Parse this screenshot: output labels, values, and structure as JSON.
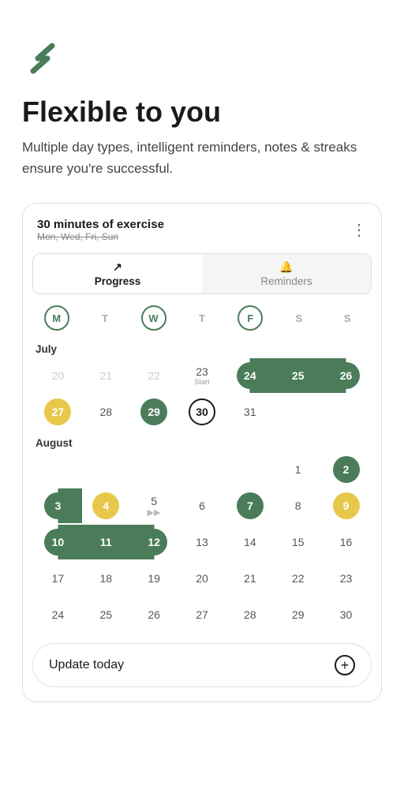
{
  "app": {
    "logo_color": "#4a7c59"
  },
  "header": {
    "headline": "Flexible to you",
    "subheadline": "Multiple day types, intelligent reminders, notes & streaks ensure you're successful."
  },
  "card": {
    "title": "30 minutes of exercise",
    "subtitle": "Mon, Wed, Fri, Sun",
    "more_icon": "⋮",
    "tabs": [
      {
        "id": "progress",
        "label": "Progress",
        "icon": "↗",
        "active": true
      },
      {
        "id": "reminders",
        "label": "Reminders",
        "icon": "🔔",
        "active": false
      }
    ],
    "weekdays": [
      {
        "label": "M",
        "active": true
      },
      {
        "label": "T",
        "active": false
      },
      {
        "label": "W",
        "active": true
      },
      {
        "label": "T",
        "active": false
      },
      {
        "label": "F",
        "active": true
      },
      {
        "label": "S",
        "active": false
      },
      {
        "label": "S",
        "active": true
      }
    ],
    "months": [
      {
        "name": "July",
        "weeks": [
          [
            "",
            "",
            "",
            "",
            "",
            "",
            ""
          ],
          [
            "20",
            "21",
            "22",
            "23_start",
            "24",
            "25",
            "26"
          ],
          [
            "27",
            "28",
            "29",
            "30",
            "31",
            "",
            ""
          ]
        ]
      },
      {
        "name": "August",
        "weeks": [
          [
            "",
            "",
            "",
            "",
            "",
            "",
            "2"
          ],
          [
            "3",
            "4",
            "5",
            "6",
            "7",
            "8",
            "9"
          ],
          [
            "10",
            "11",
            "12",
            "13",
            "14",
            "15",
            "16"
          ],
          [
            "17",
            "18",
            "19",
            "20",
            "21",
            "22",
            "23"
          ],
          [
            "24",
            "25",
            "26",
            "27",
            "28",
            "29",
            "30"
          ]
        ]
      }
    ],
    "update_button": "Update today"
  }
}
